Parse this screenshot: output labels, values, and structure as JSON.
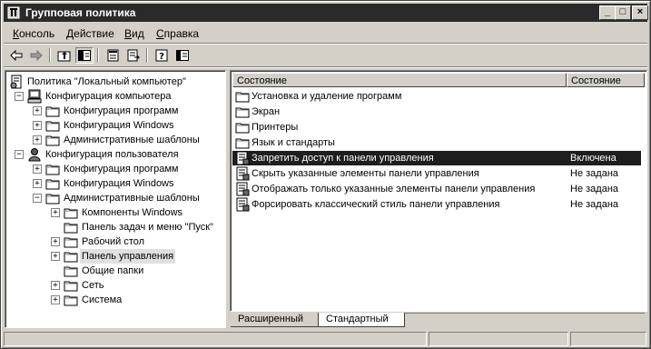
{
  "window": {
    "title": "Групповая политика",
    "controls": [
      "_",
      "□",
      "×"
    ]
  },
  "menu": {
    "items": [
      {
        "label": "Консоль",
        "u": "К",
        "rest": "онсоль"
      },
      {
        "label": "Действие",
        "u": "Д",
        "rest": "ействие"
      },
      {
        "label": "Вид",
        "u": "В",
        "rest": "ид"
      },
      {
        "label": "Справка",
        "u": "С",
        "rest": "правка"
      }
    ]
  },
  "toolbar": {
    "buttons": [
      "back-icon",
      "forward-icon",
      "up-icon",
      "show-tree-icon",
      "properties-icon",
      "export-icon",
      "help-icon",
      "pane-icon"
    ]
  },
  "tree": {
    "items": [
      {
        "label": "Политика \"Локальный компьютер\"",
        "level": 0,
        "expander": "",
        "icon": "policy"
      },
      {
        "label": "Конфигурация компьютера",
        "level": 1,
        "expander": "−",
        "icon": "computer"
      },
      {
        "label": "Конфигурация программ",
        "level": 2,
        "expander": "+",
        "icon": "folder"
      },
      {
        "label": "Конфигурация Windows",
        "level": 2,
        "expander": "+",
        "icon": "folder"
      },
      {
        "label": "Административные шаблоны",
        "level": 2,
        "expander": "+",
        "icon": "folder"
      },
      {
        "label": "Конфигурация пользователя",
        "level": 1,
        "expander": "−",
        "icon": "user"
      },
      {
        "label": "Конфигурация программ",
        "level": 2,
        "expander": "+",
        "icon": "folder"
      },
      {
        "label": "Конфигурация Windows",
        "level": 2,
        "expander": "+",
        "icon": "folder"
      },
      {
        "label": "Административные шаблоны",
        "level": 2,
        "expander": "−",
        "icon": "folder"
      },
      {
        "label": "Компоненты Windows",
        "level": 3,
        "expander": "+",
        "icon": "folder"
      },
      {
        "label": "Панель задач и меню \"Пуск\"",
        "level": 3,
        "expander": "",
        "icon": "folder"
      },
      {
        "label": "Рабочий стол",
        "level": 3,
        "expander": "+",
        "icon": "folder"
      },
      {
        "label": "Панель управления",
        "level": 3,
        "expander": "+",
        "icon": "folder",
        "selected": true
      },
      {
        "label": "Общие папки",
        "level": 3,
        "expander": "",
        "icon": "folder"
      },
      {
        "label": "Сеть",
        "level": 3,
        "expander": "+",
        "icon": "folder"
      },
      {
        "label": "Система",
        "level": 3,
        "expander": "+",
        "icon": "folder"
      }
    ]
  },
  "list": {
    "columns": [
      "Состояние",
      "Состояние"
    ],
    "rows": [
      {
        "name": "Установка и удаление программ",
        "state": "",
        "icon": "folder"
      },
      {
        "name": "Экран",
        "state": "",
        "icon": "folder"
      },
      {
        "name": "Принтеры",
        "state": "",
        "icon": "folder"
      },
      {
        "name": "Язык и стандарты",
        "state": "",
        "icon": "folder"
      },
      {
        "name": "Запретить доступ к панели управления",
        "state": "Включена",
        "icon": "setting",
        "selected": true
      },
      {
        "name": "Скрыть указанные элементы панели управления",
        "state": "Не задана",
        "icon": "setting"
      },
      {
        "name": "Отображать только указанные элементы панели управления",
        "state": "Не задана",
        "icon": "setting"
      },
      {
        "name": "Форсировать классический стиль панели управления",
        "state": "Не задана",
        "icon": "setting"
      }
    ]
  },
  "tabs": [
    {
      "label": "Расширенный",
      "active": false
    },
    {
      "label": "Стандартный",
      "active": true
    }
  ]
}
